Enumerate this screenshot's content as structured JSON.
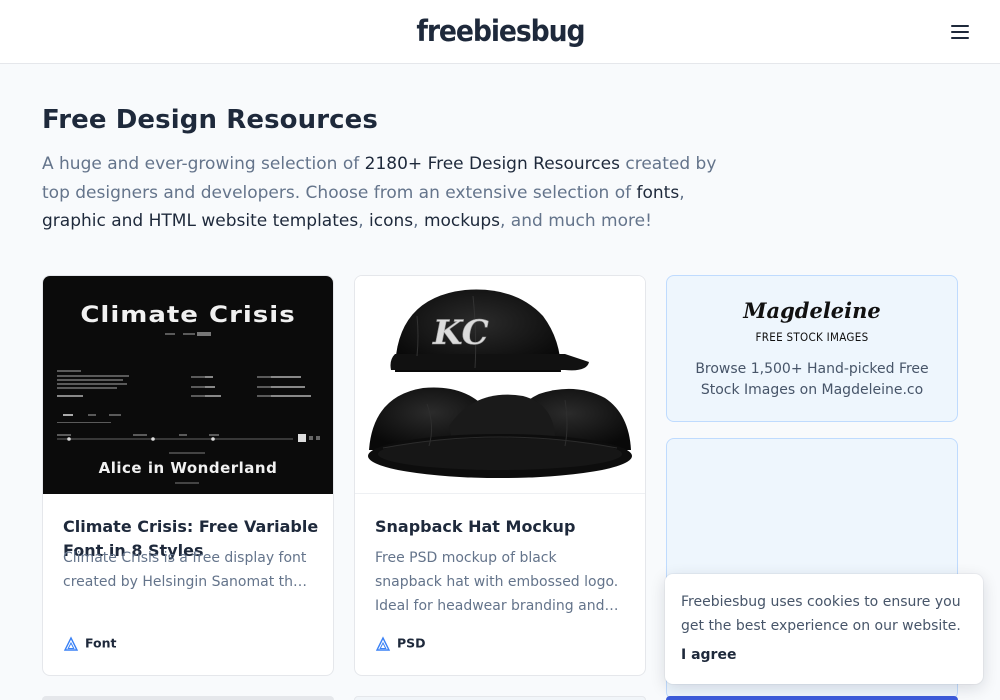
{
  "header": {
    "logo": "freebiesbug",
    "menu_icon": "hamburger-menu-icon"
  },
  "hero": {
    "title": "Free Design Resources",
    "desc_1": "A huge and ever-growing selection of ",
    "desc_link_1": "2180+ Free Design Resources",
    "desc_2": " created by top designers and developers. Choose from an extensive selection of ",
    "desc_link_fonts": "fonts",
    "desc_sep_1": ", ",
    "desc_link_templates": "graphic and HTML website templates",
    "desc_sep_2": ", ",
    "desc_link_icons": "icons",
    "desc_sep_3": ", ",
    "desc_link_mockups": "mockups",
    "desc_3": ", and much more!"
  },
  "cards": [
    {
      "title": "Climate Crisis: Free Variable Font in 8 Styles",
      "desc_line_1": "Climate Crisis is a free display font",
      "desc_line_2": "created by Helsingin Sanomat th…",
      "category": "Font",
      "category_icon": "triangle-category-icon",
      "image_text_top": "Climate Crisis",
      "image_text_bottom": "Alice in Wonderland"
    },
    {
      "title": "Snapback Hat Mockup",
      "desc_line_1": "Free PSD mockup of black",
      "desc_line_2": "snapback hat with embossed logo.",
      "desc_line_3": "Ideal for headwear branding and…",
      "category": "PSD",
      "category_icon": "triangle-category-icon"
    }
  ],
  "ad": {
    "logo": "Magdeleine",
    "sub": "FREE STOCK IMAGES",
    "text": "Browse 1,500+ Hand-picked Free Stock Images on Magdeleine.co"
  },
  "cookie": {
    "text": "Freebiesbug uses cookies to ensure you get the best experience on our website.",
    "button": "I agree"
  },
  "colors": {
    "background": "#f8fafc",
    "text_dark": "#1e293b",
    "text_muted": "#64748b",
    "ad_bg": "#eef6fd",
    "ad_border": "#bfdbfe",
    "accent_blue": "#3b5bdb"
  }
}
